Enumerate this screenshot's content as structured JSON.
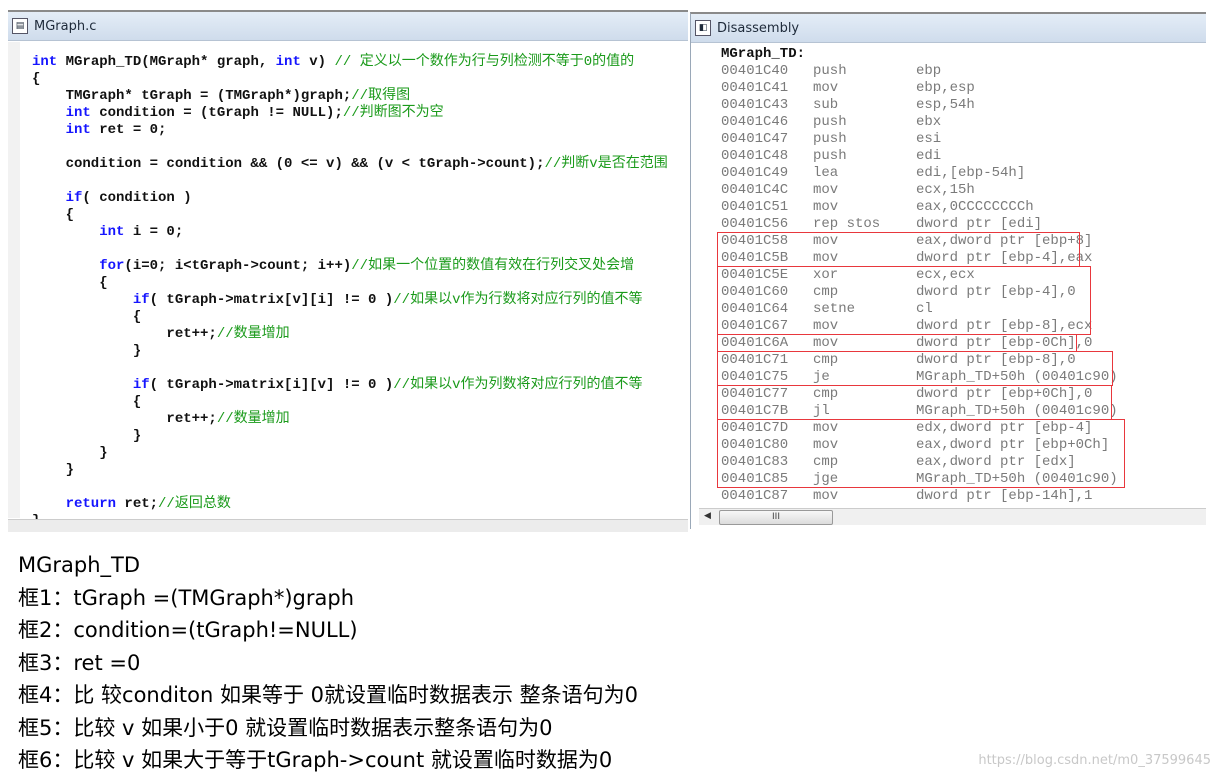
{
  "code_window": {
    "title": "MGraph.c",
    "lines": [
      [
        [
          "kw",
          "int "
        ],
        [
          "tx",
          "MGraph_TD(MGraph* graph, "
        ],
        [
          "kw",
          "int "
        ],
        [
          "tx",
          "v) "
        ],
        [
          "cm",
          "// 定义以一个数作为行与列检测不等于0的值的"
        ]
      ],
      [
        [
          "tx",
          "{"
        ]
      ],
      [
        [
          "tx",
          "    TMGraph* tGraph = (TMGraph*)graph;"
        ],
        [
          "cm",
          "//取得图"
        ]
      ],
      [
        [
          "kw",
          "    int "
        ],
        [
          "tx",
          "condition = (tGraph != NULL);"
        ],
        [
          "cm",
          "//判断图不为空"
        ]
      ],
      [
        [
          "kw",
          "    int "
        ],
        [
          "tx",
          "ret = 0;"
        ]
      ],
      [],
      [
        [
          "tx",
          "    condition = condition && (0 <= v) && (v < tGraph->count);"
        ],
        [
          "cm",
          "//判断v是否在范围"
        ]
      ],
      [],
      [
        [
          "kw",
          "    if"
        ],
        [
          "tx",
          "( condition )"
        ]
      ],
      [
        [
          "tx",
          "    {"
        ]
      ],
      [
        [
          "kw",
          "        int "
        ],
        [
          "tx",
          "i = 0;"
        ]
      ],
      [],
      [
        [
          "kw",
          "        for"
        ],
        [
          "tx",
          "(i=0; i<tGraph->count; i++)"
        ],
        [
          "cm",
          "//如果一个位置的数值有效在行列交叉处会增"
        ]
      ],
      [
        [
          "tx",
          "        {"
        ]
      ],
      [
        [
          "kw",
          "            if"
        ],
        [
          "tx",
          "( tGraph->matrix[v][i] != 0 )"
        ],
        [
          "cm",
          "//如果以v作为行数将对应行列的值不等"
        ]
      ],
      [
        [
          "tx",
          "            {"
        ]
      ],
      [
        [
          "tx",
          "                ret++;"
        ],
        [
          "cm",
          "//数量增加"
        ]
      ],
      [
        [
          "tx",
          "            }"
        ]
      ],
      [],
      [
        [
          "kw",
          "            if"
        ],
        [
          "tx",
          "( tGraph->matrix[i][v] != 0 )"
        ],
        [
          "cm",
          "//如果以v作为列数将对应行列的值不等"
        ]
      ],
      [
        [
          "tx",
          "            {"
        ]
      ],
      [
        [
          "tx",
          "                ret++;"
        ],
        [
          "cm",
          "//数量增加"
        ]
      ],
      [
        [
          "tx",
          "            }"
        ]
      ],
      [
        [
          "tx",
          "        }"
        ]
      ],
      [
        [
          "tx",
          "    }"
        ]
      ],
      [],
      [
        [
          "kw",
          "    return "
        ],
        [
          "tx",
          "ret;"
        ],
        [
          "cm",
          "//返回总数"
        ]
      ],
      [
        [
          "tx",
          "}"
        ]
      ]
    ]
  },
  "disassembly_window": {
    "title": "Disassembly",
    "label": "MGraph_TD:",
    "lines": [
      [
        "00401C40",
        "push",
        "ebp"
      ],
      [
        "00401C41",
        "mov",
        "ebp,esp"
      ],
      [
        "00401C43",
        "sub",
        "esp,54h"
      ],
      [
        "00401C46",
        "push",
        "ebx"
      ],
      [
        "00401C47",
        "push",
        "esi"
      ],
      [
        "00401C48",
        "push",
        "edi"
      ],
      [
        "00401C49",
        "lea",
        "edi,[ebp-54h]"
      ],
      [
        "00401C4C",
        "mov",
        "ecx,15h"
      ],
      [
        "00401C51",
        "mov",
        "eax,0CCCCCCCCh"
      ],
      [
        "00401C56",
        "rep stos",
        "dword ptr [edi]"
      ],
      [
        "00401C58",
        "mov",
        "eax,dword ptr [ebp+8]"
      ],
      [
        "00401C5B",
        "mov",
        "dword ptr [ebp-4],eax"
      ],
      [
        "00401C5E",
        "xor",
        "ecx,ecx"
      ],
      [
        "00401C60",
        "cmp",
        "dword ptr [ebp-4],0"
      ],
      [
        "00401C64",
        "setne",
        "cl"
      ],
      [
        "00401C67",
        "mov",
        "dword ptr [ebp-8],ecx"
      ],
      [
        "00401C6A",
        "mov",
        "dword ptr [ebp-0Ch],0"
      ],
      [
        "00401C71",
        "cmp",
        "dword ptr [ebp-8],0"
      ],
      [
        "00401C75",
        "je",
        "MGraph_TD+50h (00401c90)"
      ],
      [
        "00401C77",
        "cmp",
        "dword ptr [ebp+0Ch],0"
      ],
      [
        "00401C7B",
        "jl",
        "MGraph_TD+50h (00401c90)"
      ],
      [
        "00401C7D",
        "mov",
        "edx,dword ptr [ebp-4]"
      ],
      [
        "00401C80",
        "mov",
        "eax,dword ptr [ebp+0Ch]"
      ],
      [
        "00401C83",
        "cmp",
        "eax,dword ptr [edx]"
      ],
      [
        "00401C85",
        "jge",
        "MGraph_TD+50h (00401c90)"
      ],
      [
        "00401C87",
        "mov",
        "dword ptr [ebp-14h],1"
      ]
    ],
    "highlight_groups": [
      [
        10,
        11
      ],
      [
        12,
        15
      ],
      [
        16,
        16
      ],
      [
        17,
        18
      ],
      [
        19,
        20
      ],
      [
        21,
        24
      ]
    ],
    "highlight_color": "#e8373d",
    "scroll_thumb_glyph": "III"
  },
  "notes": [
    "MGraph_TD",
    "框1：tGraph =(TMGraph*)graph",
    "框2：condition=(tGraph!=NULL)",
    "框3：ret =0",
    "框4：比 较conditon 如果等于 0就设置临时数据表示 整条语句为0",
    "框5：比较 v 如果小于0 就设置临时数据表示整条语句为0",
    "框6：比较 v 如果大于等于tGraph->count  就设置临时数据为0"
  ],
  "watermark": "https://blog.csdn.net/m0_37599645"
}
